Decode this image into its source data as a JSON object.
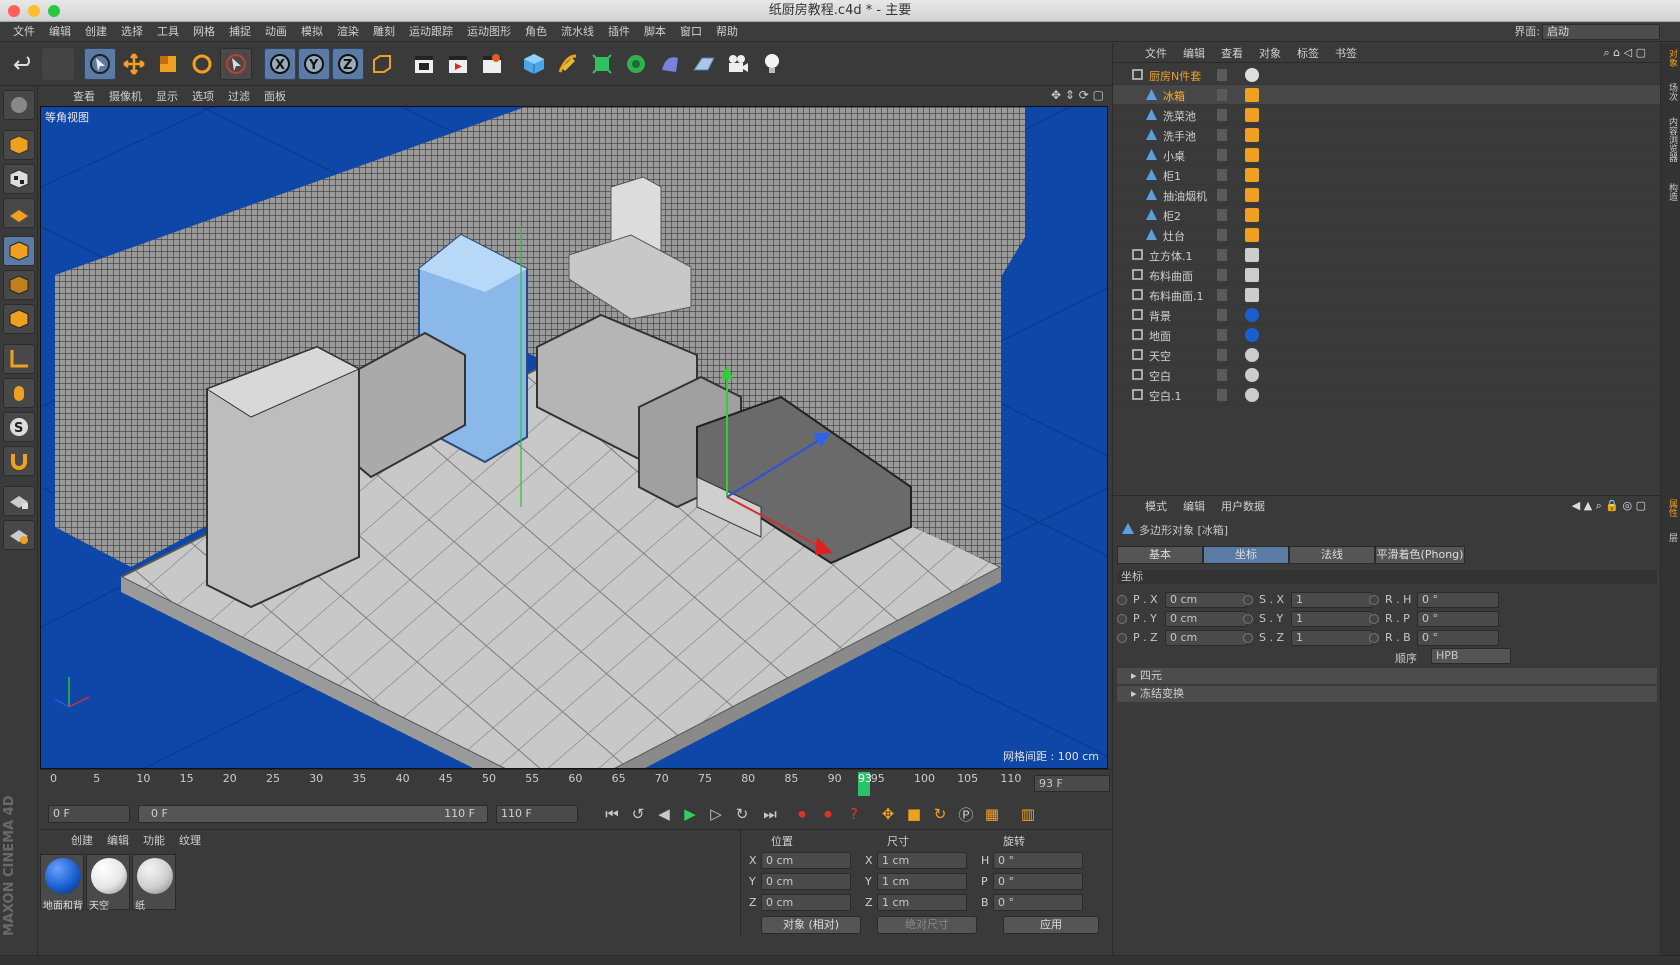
{
  "window": {
    "title": "纸厨房教程.c4d * - 主要"
  },
  "menubar": {
    "items": [
      "文件",
      "编辑",
      "创建",
      "选择",
      "工具",
      "网格",
      "捕捉",
      "动画",
      "模拟",
      "渲染",
      "雕刻",
      "运动跟踪",
      "运动图形",
      "角色",
      "流水线",
      "插件",
      "脚本",
      "窗口",
      "帮助"
    ],
    "layout_label": "界面:",
    "layout_value": "启动"
  },
  "viewport": {
    "menu": [
      "查看",
      "摄像机",
      "显示",
      "选项",
      "过滤",
      "面板"
    ],
    "label": "等角视图",
    "grid_info": "网格间距 : 100 cm"
  },
  "timeline": {
    "ticks": [
      "0",
      "5",
      "10",
      "15",
      "20",
      "25",
      "30",
      "35",
      "40",
      "45",
      "50",
      "55",
      "60",
      "65",
      "70",
      "75",
      "80",
      "85",
      "90",
      "95",
      "100",
      "105",
      "110"
    ],
    "current_frame": "93",
    "end_field": "93 F",
    "start_field": "0 F",
    "range_start": "0 F",
    "range_end": "110 F",
    "max_field": "110 F"
  },
  "materials": {
    "menu": [
      "创建",
      "编辑",
      "功能",
      "纹理"
    ],
    "items": [
      {
        "label": "地面和背",
        "color": "#1a5fd0"
      },
      {
        "label": "天空",
        "color": "#e6e6e6"
      },
      {
        "label": "纸",
        "color": "#cfcfcf"
      }
    ]
  },
  "coords": {
    "headers": {
      "pos": "位置",
      "size": "尺寸",
      "rot": "旋转"
    },
    "rows": [
      {
        "axis": "X",
        "pos": "0 cm",
        "saxis": "X",
        "size": "1 cm",
        "raxis": "H",
        "rot": "0 °"
      },
      {
        "axis": "Y",
        "pos": "0 cm",
        "saxis": "Y",
        "size": "1 cm",
        "raxis": "P",
        "rot": "0 °"
      },
      {
        "axis": "Z",
        "pos": "0 cm",
        "saxis": "Z",
        "size": "1 cm",
        "raxis": "B",
        "rot": "0 °"
      }
    ],
    "mode": "对象 (相对)",
    "size_mode": "绝对尺寸",
    "apply": "应用"
  },
  "objects": {
    "menu": [
      "文件",
      "编辑",
      "查看",
      "对象",
      "标签",
      "书签"
    ],
    "rows": [
      {
        "name": "厨房N件套",
        "indent": 0,
        "color": "#e8a030"
      },
      {
        "name": "冰箱",
        "indent": 1,
        "color": "#ffb030"
      },
      {
        "name": "洗菜池",
        "indent": 1,
        "color": "#d0d0d0"
      },
      {
        "name": "洗手池",
        "indent": 1,
        "color": "#d0d0d0"
      },
      {
        "name": "小桌",
        "indent": 1,
        "color": "#d0d0d0"
      },
      {
        "name": "柜1",
        "indent": 1,
        "color": "#d0d0d0"
      },
      {
        "name": "抽油烟机",
        "indent": 1,
        "color": "#d0d0d0"
      },
      {
        "name": "柜2",
        "indent": 1,
        "color": "#d0d0d0"
      },
      {
        "name": "灶台",
        "indent": 1,
        "color": "#d0d0d0"
      },
      {
        "name": "立方体.1",
        "indent": 0,
        "color": "#d0d0d0"
      },
      {
        "name": "布料曲面",
        "indent": 0,
        "color": "#d0d0d0"
      },
      {
        "name": "布料曲面.1",
        "indent": 0,
        "color": "#d0d0d0"
      },
      {
        "name": "背景",
        "indent": 0,
        "color": "#d0d0d0"
      },
      {
        "name": "地面",
        "indent": 0,
        "color": "#d0d0d0"
      },
      {
        "name": "天空",
        "indent": 0,
        "color": "#d0d0d0"
      },
      {
        "name": "空白",
        "indent": 0,
        "color": "#d0d0d0"
      },
      {
        "name": "空白.1",
        "indent": 0,
        "color": "#d0d0d0"
      }
    ]
  },
  "attributes": {
    "menu": [
      "模式",
      "编辑",
      "用户数据"
    ],
    "object_title": "多边形对象 [冰箱]",
    "tabs": [
      "基本",
      "坐标",
      "法线",
      "平滑着色(Phong)"
    ],
    "active_tab": "坐标",
    "section": "坐标",
    "rows": [
      {
        "p": "P . X",
        "pv": "0 cm",
        "s": "S . X",
        "sv": "1",
        "r": "R . H",
        "rv": "0 °"
      },
      {
        "p": "P . Y",
        "pv": "0 cm",
        "s": "S . Y",
        "sv": "1",
        "r": "R . P",
        "rv": "0 °"
      },
      {
        "p": "P . Z",
        "pv": "0 cm",
        "s": "S . Z",
        "sv": "1",
        "r": "R . B",
        "rv": "0 °"
      }
    ],
    "order_label": "顺序",
    "order_value": "HPB",
    "collapsed": [
      "四元",
      "冻结变换"
    ]
  },
  "sidetabs": [
    "对象",
    "场次",
    "内容浏览器",
    "构造",
    "属性",
    "层"
  ],
  "brand": "MAXON CINEMA 4D"
}
